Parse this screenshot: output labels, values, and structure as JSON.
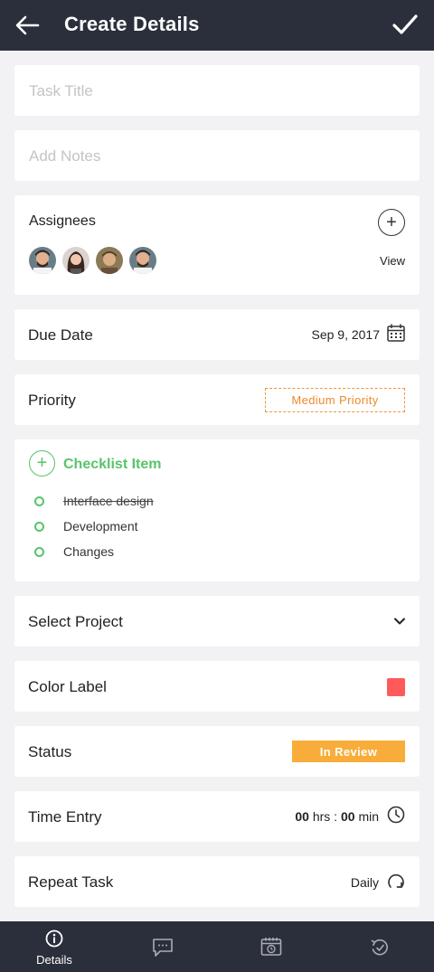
{
  "header": {
    "title": "Create Details"
  },
  "form": {
    "task_title_placeholder": "Task Title",
    "notes_placeholder": "Add Notes"
  },
  "assignees": {
    "label": "Assignees",
    "view_label": "View",
    "count": 4
  },
  "due_date": {
    "label": "Due Date",
    "value": "Sep 9, 2017"
  },
  "priority": {
    "label": "Priority",
    "value": "Medium Priority"
  },
  "checklist": {
    "title": "Checklist Item",
    "items": [
      {
        "label": "Interface design",
        "done": true
      },
      {
        "label": "Development",
        "done": false
      },
      {
        "label": "Changes",
        "done": false
      }
    ]
  },
  "project": {
    "label": "Select Project"
  },
  "color_label": {
    "label": "Color Label",
    "color": "#ff5a5a"
  },
  "status": {
    "label": "Status",
    "value": "In Review"
  },
  "time_entry": {
    "label": "Time Entry",
    "hours": "00",
    "hrs_unit": "hrs :",
    "minutes": "00",
    "min_unit": "min"
  },
  "repeat": {
    "label": "Repeat Task",
    "value": "Daily"
  },
  "tabs": [
    {
      "label": "Details",
      "icon": "info-icon",
      "active": true
    },
    {
      "label": "",
      "icon": "chat-icon",
      "active": false
    },
    {
      "label": "",
      "icon": "calendar-clock-icon",
      "active": false
    },
    {
      "label": "",
      "icon": "history-icon",
      "active": false
    }
  ],
  "colors": {
    "bar": "#2b2f3b",
    "accent_green": "#58c46a",
    "priority_orange": "#ee8a2a",
    "status_orange": "#f8ac3a"
  }
}
